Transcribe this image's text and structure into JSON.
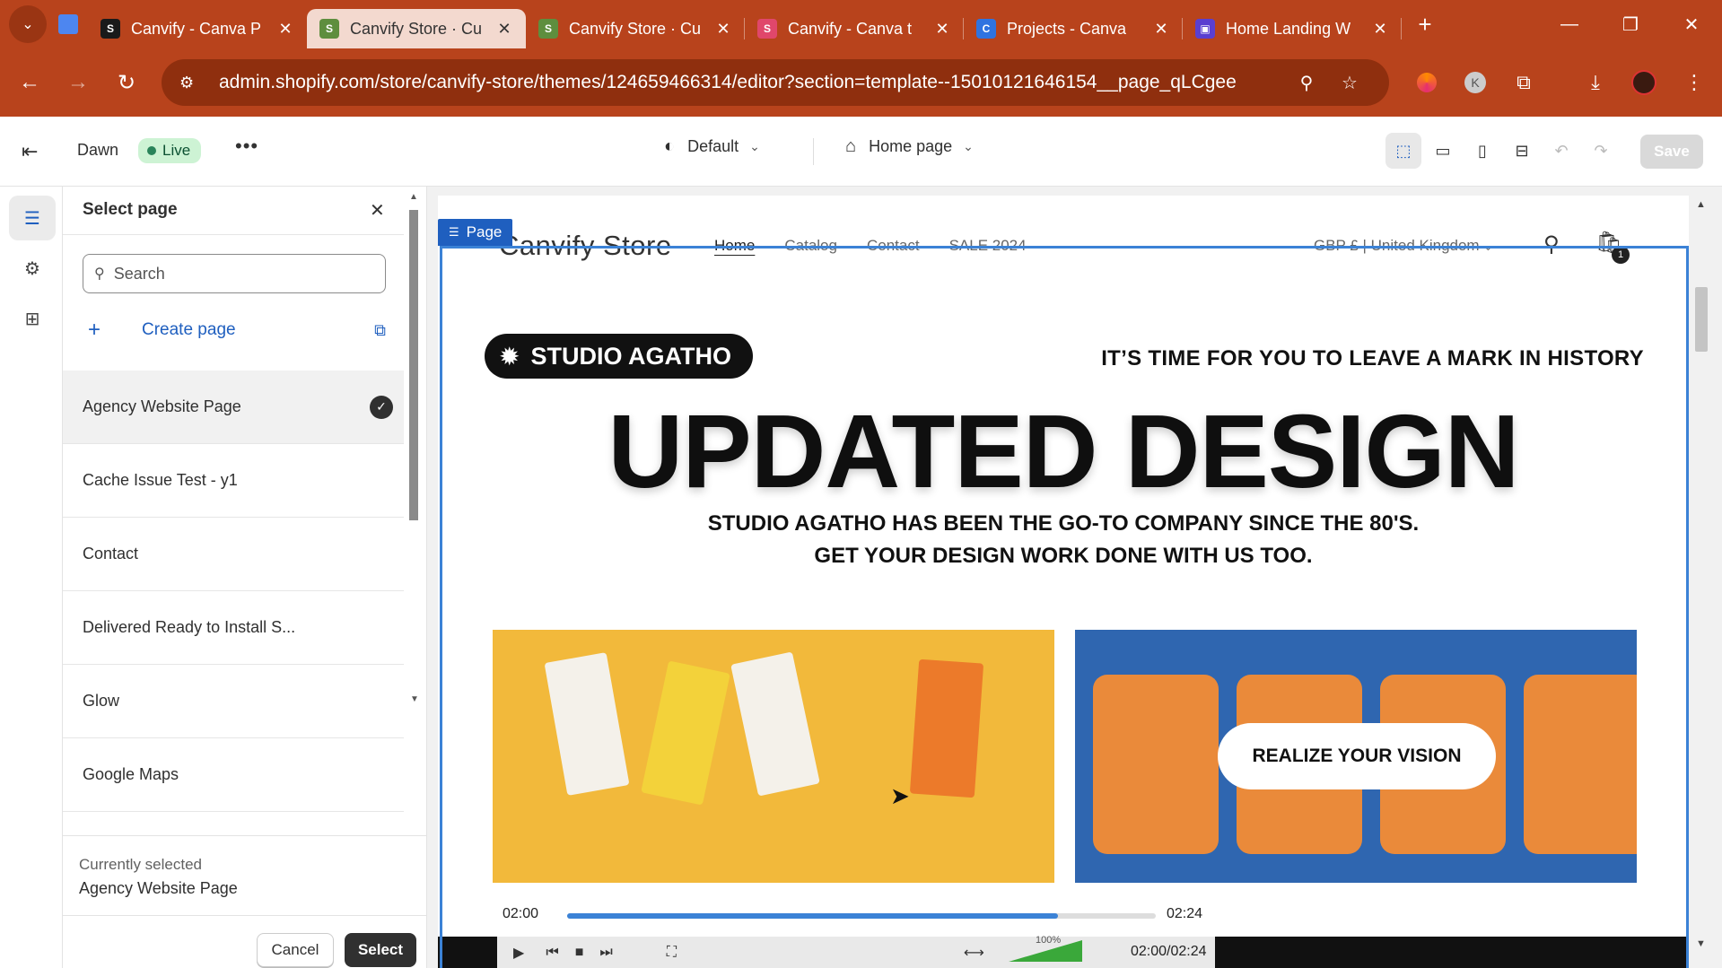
{
  "browser": {
    "tabs": [
      {
        "title": "Canvify - Canva P",
        "fav_bg": "#1a1a1a",
        "fav_glyph": "S"
      },
      {
        "title": "Canvify Store · Cu",
        "fav_bg": "#5e8e3e",
        "fav_glyph": "S"
      },
      {
        "title": "Canvify Store · Cu",
        "fav_bg": "#5e8e3e",
        "fav_glyph": "S"
      },
      {
        "title": "Canvify - Canva t",
        "fav_bg": "#e0476b",
        "fav_glyph": "S"
      },
      {
        "title": "Projects - Canva",
        "fav_bg": "#2f73e0",
        "fav_glyph": "C"
      },
      {
        "title": "Home Landing W",
        "fav_bg": "#5a3fd0",
        "fav_glyph": "▣"
      }
    ],
    "active_tab_index": 1,
    "url": "admin.shopify.com/store/canvify-store/themes/124659466314/editor?section=template--15010121646154__page_qLCgee",
    "profile_letter": "K",
    "accent": "#b8431c"
  },
  "topbar": {
    "theme_name": "Dawn",
    "live_label": "Live",
    "template_label": "Default",
    "page_label": "Home page",
    "save_label": "Save"
  },
  "panel": {
    "title": "Select page",
    "search_placeholder": "Search",
    "create_label": "Create page",
    "pages": [
      {
        "label": "Agency Website Page",
        "selected": true
      },
      {
        "label": "Cache Issue Test - y1",
        "selected": false
      },
      {
        "label": "Contact",
        "selected": false
      },
      {
        "label": "Delivered Ready to Install S...",
        "selected": false
      },
      {
        "label": "Glow",
        "selected": false
      },
      {
        "label": "Google Maps",
        "selected": false
      }
    ],
    "currently_selected_label": "Currently selected",
    "currently_selected_value": "Agency Website Page",
    "cancel_label": "Cancel",
    "select_label": "Select"
  },
  "preview": {
    "page_tag": "Page",
    "store_name": "Canvify Store",
    "nav": [
      "Home",
      "Catalog",
      "Contact",
      "SALE 2024"
    ],
    "currency": "GBP £ | United Kingdom",
    "cart_count": "1",
    "brand_pill": "STUDIO AGATHO",
    "tagline": "IT’S TIME FOR YOU TO LEAVE A MARK IN HISTORY",
    "headline": "UPDATED DESIGN",
    "sub_line1": "STUDIO AGATHO HAS BEEN THE GO-TO COMPANY SINCE THE 80'S.",
    "sub_line2": "GET YOUR DESIGN WORK DONE WITH US TOO.",
    "image_button": "REALIZE YOUR VISION",
    "player": {
      "current": "02:00",
      "duration": "02:24",
      "progress": 0.8333,
      "volume_label": "100%",
      "combined": "02:00/02:24"
    }
  }
}
